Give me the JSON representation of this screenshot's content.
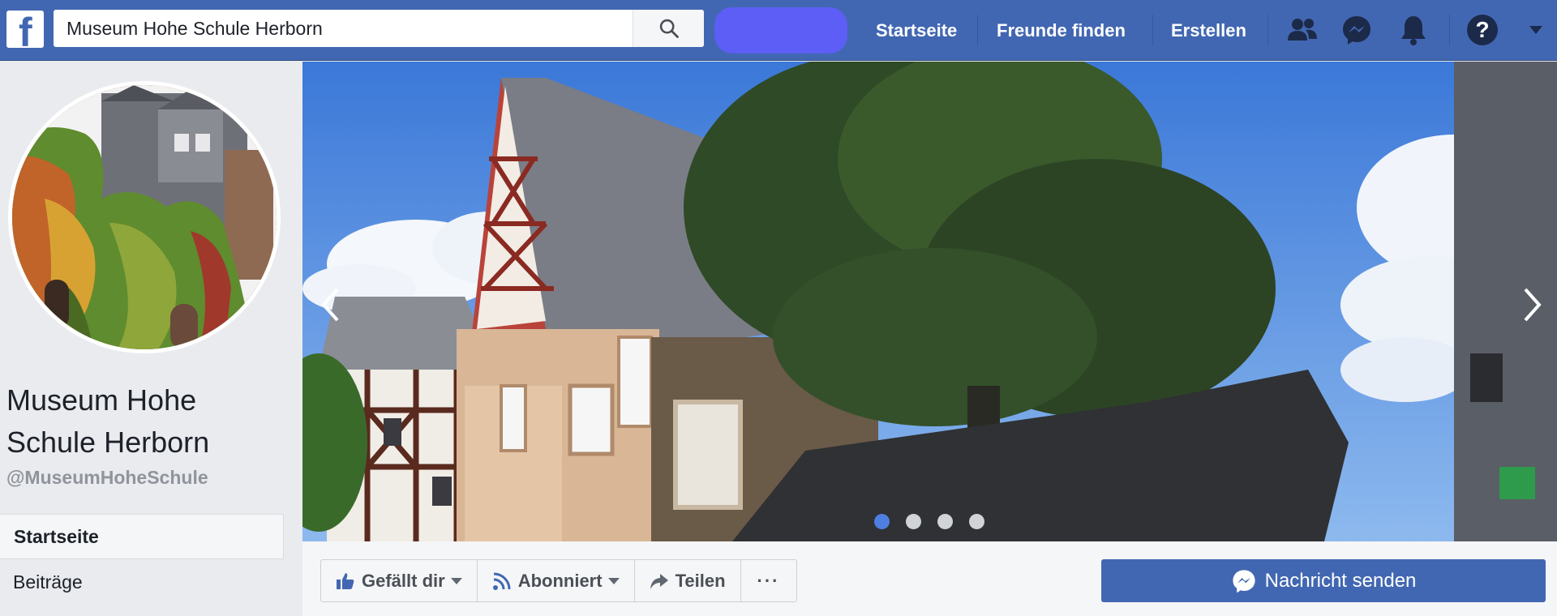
{
  "topbar": {
    "logo_letter": "f",
    "search": {
      "value": "Museum Hohe Schule Herborn",
      "icon": "search-icon"
    },
    "nav": [
      "Startseite",
      "Freunde finden",
      "Erstellen"
    ],
    "icons": [
      "friend-requests-icon",
      "messenger-icon",
      "notifications-bell-icon",
      "help-icon",
      "account-menu-caret-icon"
    ],
    "help_label": "?"
  },
  "page": {
    "name": "Museum Hohe Schule Herborn",
    "handle": "@MuseumHoheSchule"
  },
  "left_nav": {
    "items": [
      "Startseite",
      "Beiträge"
    ]
  },
  "cover": {
    "slide_count": 4,
    "active_slide": 1
  },
  "actions": {
    "like": "Gefällt dir",
    "follow": "Abonniert",
    "share": "Teilen",
    "more": "···",
    "message": "Nachricht senden"
  },
  "colors": {
    "brand": "#4267b2",
    "profile_pill": "#5c5ef5",
    "active_dot": "#4e7fe0"
  }
}
